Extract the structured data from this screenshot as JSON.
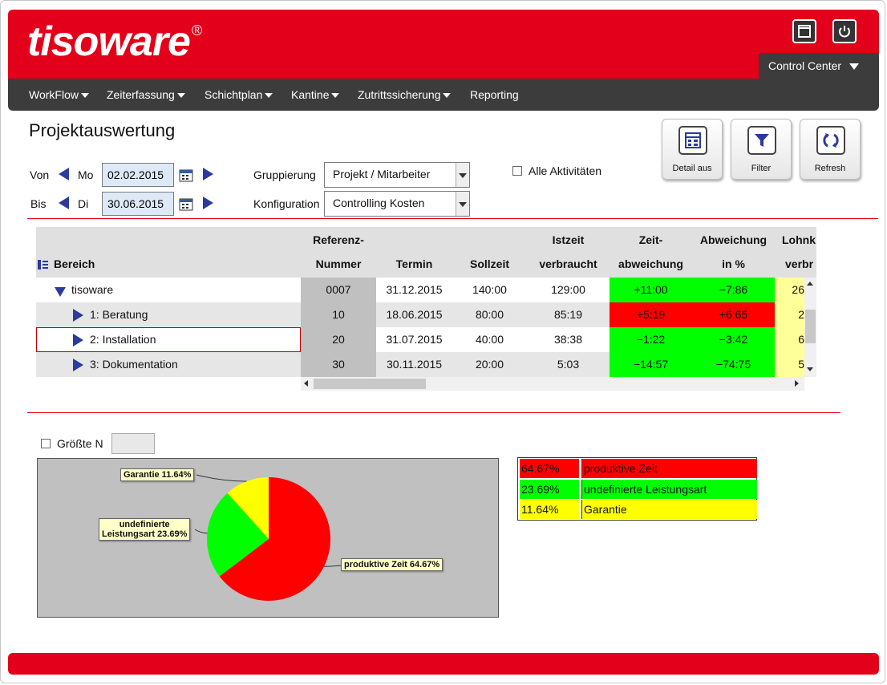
{
  "app": {
    "logo": "tisoware",
    "logo_mark": "®",
    "control_center": "Control Center"
  },
  "nav": {
    "workflow": "WorkFlow",
    "zeiterfassung": "Zeiterfassung",
    "schichtplan": "Schichtplan",
    "kantine": "Kantine",
    "zutritt": "Zutrittssicherung",
    "reporting": "Reporting"
  },
  "page": {
    "title": "Projektauswertung"
  },
  "filters": {
    "von_label": "Von",
    "von_day": "Mo",
    "von_date": "02.02.2015",
    "bis_label": "Bis",
    "bis_day": "Di",
    "bis_date": "30.06.2015",
    "gruppierung_label": "Gruppierung",
    "gruppierung_value": "Projekt / Mitarbeiter",
    "konfiguration_label": "Konfiguration",
    "konfiguration_value": "Controlling Kosten",
    "alle_label": "Alle Aktivitäten"
  },
  "toolbar": {
    "detail": "Detail aus",
    "filter": "Filter",
    "refresh": "Refresh"
  },
  "table": {
    "headers": {
      "bereich": "Bereich",
      "ref1": "Referenz-",
      "ref2": "Nummer",
      "termin": "Termin",
      "soll": "Sollzeit",
      "ist1": "Istzeit",
      "ist2": "verbraucht",
      "zeit1": "Zeit-",
      "zeit2": "abweichung",
      "abw1": "Abweichung",
      "abw2": "in %",
      "lohn1": "Lohnk",
      "lohn2": "verbr"
    },
    "rows": [
      {
        "name": "tisoware",
        "ref": "0007",
        "termin": "31.12.2015",
        "soll": "140:00",
        "ist": "129:00",
        "zeit": "+11:00",
        "abw": "−7:86",
        "lohn": "26"
      },
      {
        "name": "1: Beratung",
        "ref": "10",
        "termin": "18.06.2015",
        "soll": "80:00",
        "ist": "85:19",
        "zeit": "+5:19",
        "abw": "+6:65",
        "lohn": "2"
      },
      {
        "name": "2: Installation",
        "ref": "20",
        "termin": "31.07.2015",
        "soll": "40:00",
        "ist": "38:38",
        "zeit": "−1:22",
        "abw": "−3:42",
        "lohn": "6"
      },
      {
        "name": "3: Dokumentation",
        "ref": "30",
        "termin": "30.11.2015",
        "soll": "20:00",
        "ist": "5:03",
        "zeit": "−14:57",
        "abw": "−74:75",
        "lohn": "5"
      }
    ]
  },
  "groesste": {
    "label": "Größte N",
    "value": ""
  },
  "chart_data": {
    "type": "pie",
    "slices": [
      {
        "label": "produktive Zeit",
        "value": 64.67,
        "color": "#ff0000",
        "callout": "produktive Zeit 64.67%"
      },
      {
        "label": "undefinierte Leistungsart",
        "value": 23.69,
        "color": "#00ff00",
        "callout1": "undefinierte",
        "callout2": "Leistungsart 23.69%"
      },
      {
        "label": "Garantie",
        "value": 11.64,
        "color": "#ffff00",
        "callout": "Garantie 11.64%"
      }
    ]
  },
  "legend": [
    {
      "pct": "64.67%",
      "label": "produktive Zeit",
      "color": "#ff0000"
    },
    {
      "pct": "23.69%",
      "label": "undefinierte Leistungsart",
      "color": "#00ff00"
    },
    {
      "pct": "11.64%",
      "label": "Garantie",
      "color": "#ffff00"
    }
  ]
}
